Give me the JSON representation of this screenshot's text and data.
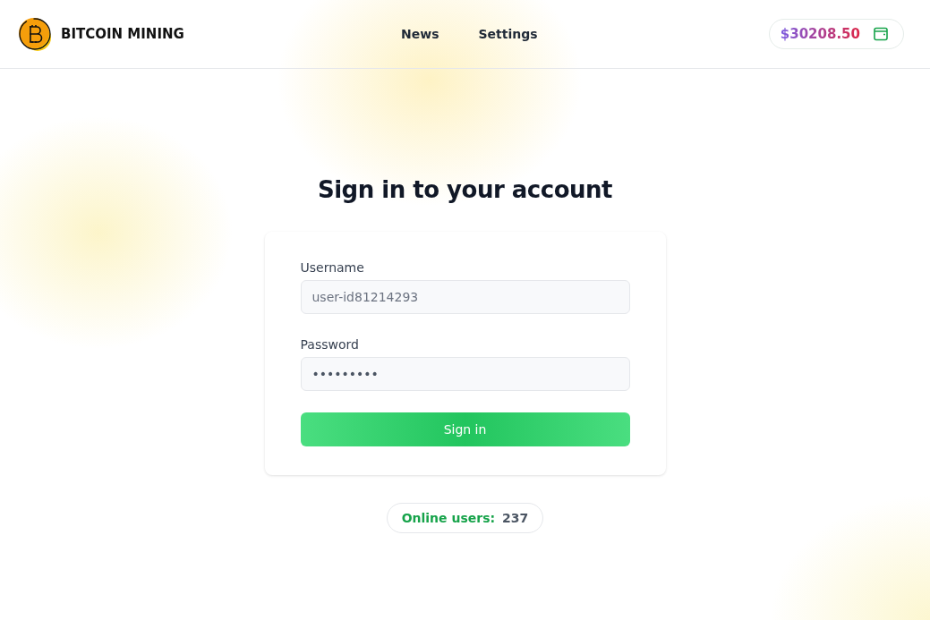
{
  "header": {
    "brand": "BITCOIN MINING",
    "nav": [
      {
        "label": "News"
      },
      {
        "label": "Settings"
      }
    ],
    "balance": "$30208.50"
  },
  "title": "Sign in to your account",
  "form": {
    "fields": [
      {
        "label": "Username",
        "placeholder": "user-id81214293"
      },
      {
        "label": "Password",
        "value": "•••••••••"
      }
    ],
    "submit": "Sign in"
  },
  "online": {
    "label": "Online users:",
    "count": "237"
  }
}
